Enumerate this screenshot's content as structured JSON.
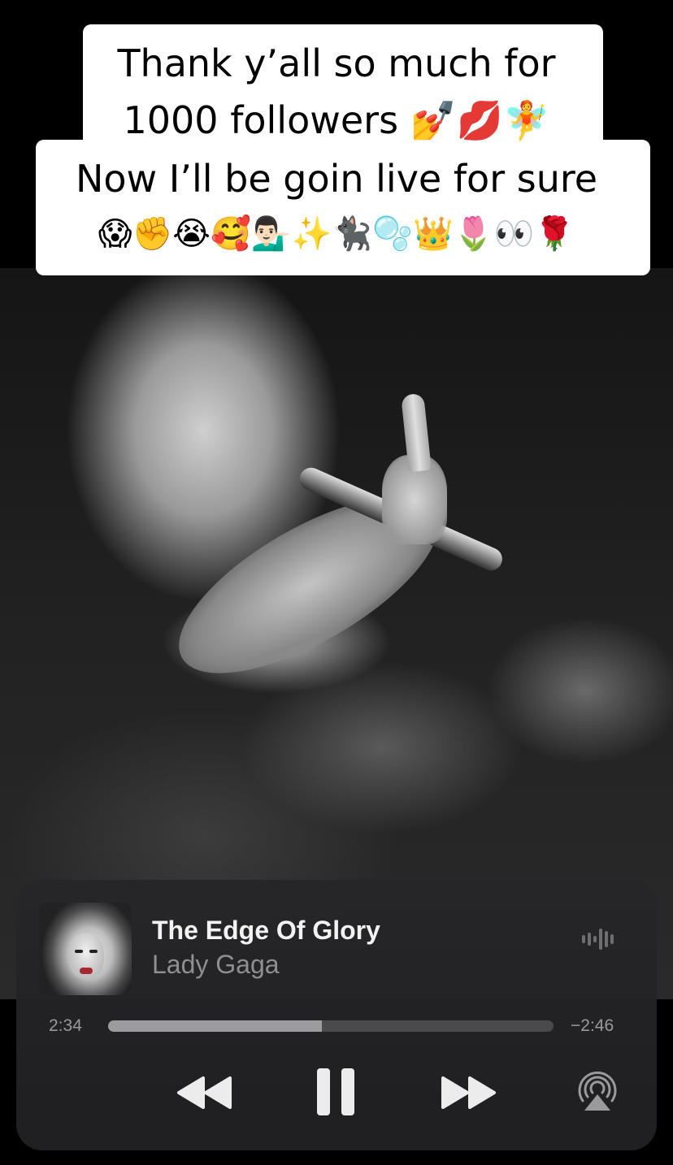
{
  "caption": {
    "line1": "Thank y’all so much for",
    "line2": "1000 followers 💅💋🧚",
    "line3": "Now I’ll be goin live for sure",
    "line4": "😱✊😭🥰💁🏻‍♂️✨🐈‍⬛🫧👑🌷👀🌹"
  },
  "now_playing": {
    "title": "The Edge Of Glory",
    "artist": "Lady Gaga",
    "elapsed": "2:34",
    "remaining": "−2:46",
    "progress_fraction": 0.48
  },
  "controls": {
    "rewind_icon": "rewind-icon",
    "pause_icon": "pause-icon",
    "forward_icon": "fast-forward-icon",
    "airplay_icon": "airplay-icon",
    "waveform_icon": "waveform-icon"
  },
  "colors": {
    "player_bg": "#262628",
    "title": "#f2f2f2",
    "artist": "#8e8e93",
    "scrubber_track": "#4a4a4d",
    "scrubber_fill": "#9c9ca0"
  }
}
